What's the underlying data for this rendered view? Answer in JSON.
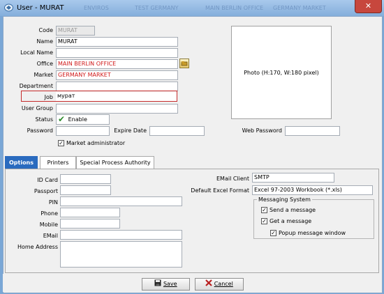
{
  "window": {
    "title": "User - MURAT",
    "background_tabs": [
      "ENVIROS",
      "TEST GERMANY",
      "MAIN BERLIN OFFICE",
      "GERMANY MARKET"
    ],
    "close_glyph": "✕"
  },
  "form": {
    "code_label": "Code",
    "code_value": "MURAT",
    "name_label": "Name",
    "name_value": "MURAT",
    "local_name_label": "Local Name",
    "local_name_value": "",
    "office_label": "Office",
    "office_value": "MAIN BERLIN OFFICE",
    "market_label": "Market",
    "market_value": "GERMANY MARKET",
    "department_label": "Department",
    "department_value": "",
    "job_label": "Job",
    "job_value": "мурат",
    "user_group_label": "User Group",
    "user_group_value": "",
    "status_label": "Status",
    "status_value": "Enable",
    "password_label": "Password",
    "password_value": "",
    "expire_date_label": "Expire Date",
    "expire_date_value": "",
    "web_password_label": "Web Password",
    "web_password_value": "",
    "market_admin_label": "Market administrator",
    "market_admin_checked": true,
    "photo_placeholder": "Photo (H:170, W:180 pixel)"
  },
  "tabs": [
    "Options",
    "Printers",
    "Special Process Authority"
  ],
  "options": {
    "id_card_label": "ID Card",
    "id_card_value": "",
    "passport_label": "Passport",
    "passport_value": "",
    "pin_label": "PIN",
    "pin_value": "",
    "phone_label": "Phone",
    "phone_value": "",
    "mobile_label": "Mobile",
    "mobile_value": "",
    "email_label": "EMail",
    "email_value": "",
    "home_address_label": "Home Address",
    "home_address_value": "",
    "email_client_label": "EMail Client",
    "email_client_value": "SMTP",
    "excel_format_label": "Default Excel Format",
    "excel_format_value": "Excel 97-2003 Workbook (*.xls)",
    "messaging": {
      "title": "Messaging System",
      "send_label": "Send a message",
      "send_checked": true,
      "get_label": "Get a message",
      "get_checked": true,
      "popup_label": "Popup message window",
      "popup_checked": true
    }
  },
  "buttons": {
    "save": "Save",
    "cancel": "Cancel"
  },
  "colors": {
    "title_bar": "#84aedb",
    "active_tab": "#2a6bbf",
    "required_text": "#d01818",
    "close": "#c7473d"
  }
}
